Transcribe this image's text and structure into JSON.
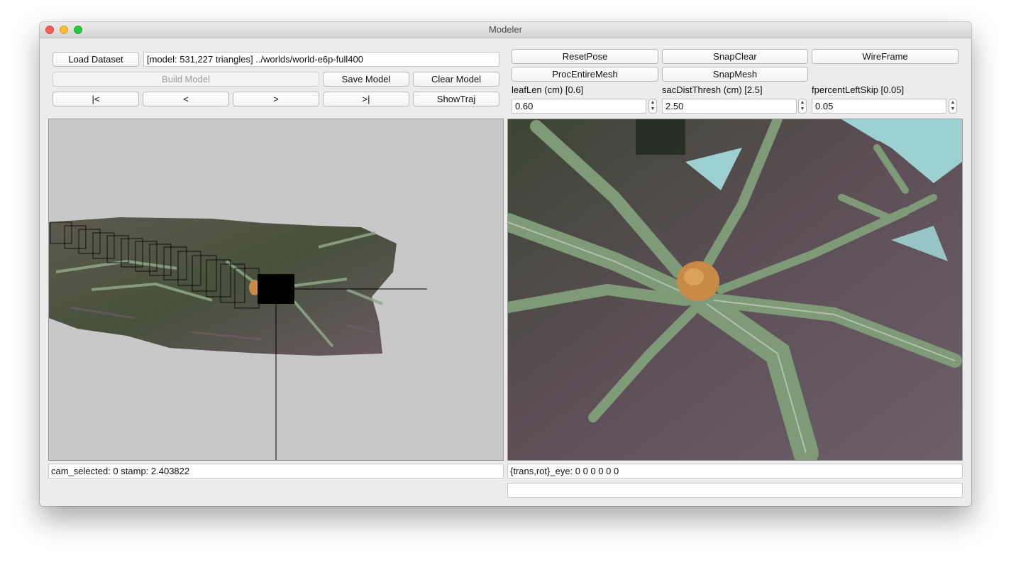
{
  "window": {
    "title": "Modeler"
  },
  "toolbar": {
    "load_dataset": "Load Dataset",
    "model_info": "[model: 531,227 triangles] ../worlds/world-e6p-full400",
    "build_model": "Build Model",
    "save_model": "Save Model",
    "clear_model": "Clear Model",
    "nav_first": "|<",
    "nav_prev": "<",
    "nav_next": ">",
    "nav_last": ">|",
    "show_traj": "ShowTraj"
  },
  "controls": {
    "reset_pose": "ResetPose",
    "snap_clear": "SnapClear",
    "wireframe": "WireFrame",
    "proc_entire_mesh": "ProcEntireMesh",
    "snap_mesh": "SnapMesh",
    "leaf_len_label": "leafLen (cm) [0.6]",
    "leaf_len_value": "0.60",
    "sac_dist_label": "sacDistThresh (cm) [2.5]",
    "sac_dist_value": "2.50",
    "fpercent_label": "fpercentLeftSkip [0.05]",
    "fpercent_value": "0.05"
  },
  "status": {
    "left": "cam_selected: 0 stamp: 2.403822",
    "right": "{trans,rot}_eye: 0 0 0 0 0 0",
    "bottom": ""
  },
  "colors": {
    "background": "#ececec",
    "viewport_left_bg": "#c8c8c8",
    "viewport_right_bg": "#9dd0d0"
  },
  "icons": {
    "close": "close-button",
    "minimize": "minimize-button",
    "maximize": "maximize-button",
    "spinner": "stepper-arrows-icon"
  }
}
